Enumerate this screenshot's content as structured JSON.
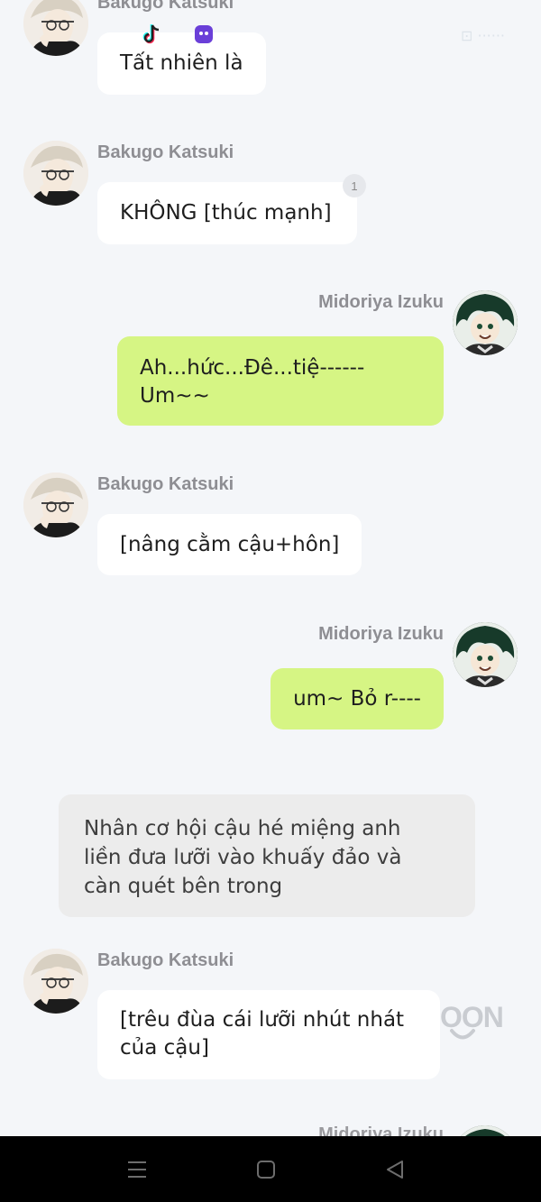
{
  "messages": [
    {
      "sender": "Bakugo Katsuki",
      "text": "Tất nhiên là"
    },
    {
      "sender": "Bakugo Katsuki",
      "text": "KHÔNG [thúc mạnh]",
      "badge": "1"
    },
    {
      "sender": "Midoriya Izuku",
      "lines": [
        "Ah...hức...Đê...tiệ------",
        "Um~~"
      ]
    },
    {
      "sender": "Bakugo Katsuki",
      "text": "[nâng cằm cậu+hôn]"
    },
    {
      "sender": "Midoriya Izuku",
      "text": "um~ Bỏ r----"
    },
    {
      "sender": "Bakugo Katsuki",
      "lines": [
        "[trêu đùa cái lưỡi nhút nhát",
        "của cậu]"
      ]
    }
  ],
  "narration": {
    "lines": [
      "Nhân cơ hội cậu hé miệng anh",
      "liền đưa lưỡi vào khuấy đảo và",
      "càn quét bên trong"
    ]
  },
  "watermark": "OON",
  "partial_name": "Midoriya Izuku",
  "status": {
    "faint_text": "⊡ ······"
  },
  "icons": {
    "status": [
      "tiktok-icon",
      "game-controller-icon"
    ],
    "nav": [
      "menu-icon",
      "home-icon",
      "back-icon"
    ]
  },
  "colors": {
    "incoming_bubble": "#ffffff",
    "outgoing_bubble": "#d6f584",
    "narration_bubble": "#ececec",
    "background": "#f4f6f9",
    "navbar": "#000000"
  }
}
